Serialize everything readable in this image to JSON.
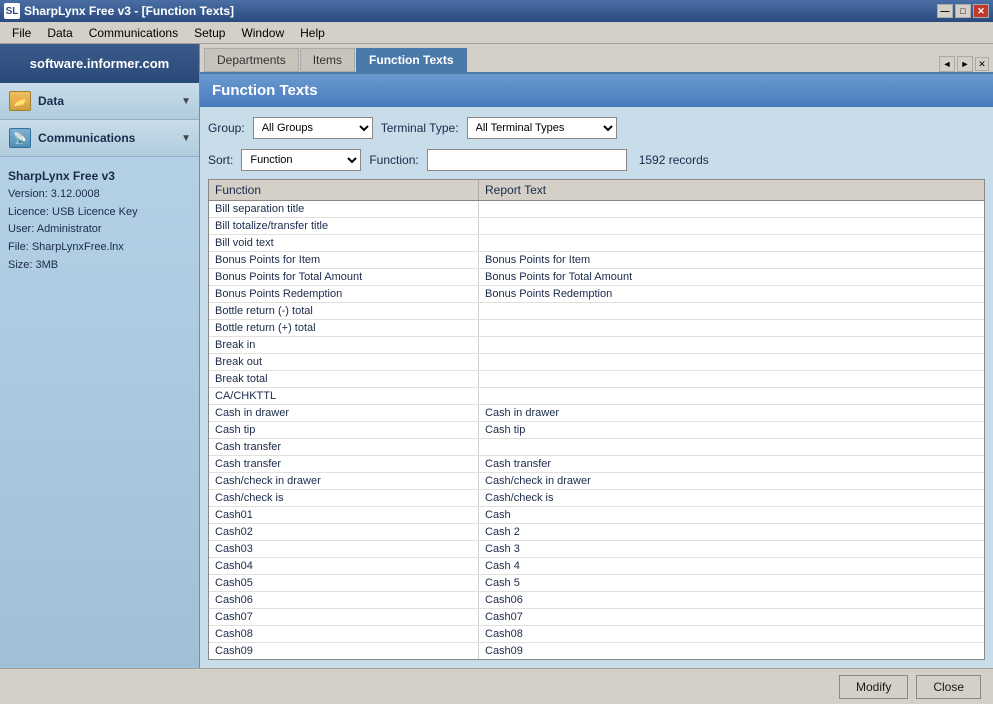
{
  "window": {
    "title": "SharpLynx Free v3 - [Function Texts]",
    "icon": "SL"
  },
  "menubar": {
    "items": [
      "File",
      "Data",
      "Communications",
      "Setup",
      "Window",
      "Help"
    ]
  },
  "sidebar": {
    "logo": "software.informer.com",
    "sections": [
      {
        "id": "data",
        "label": "Data",
        "icon": "📂"
      },
      {
        "id": "communications",
        "label": "Communications",
        "icon": "📡"
      }
    ],
    "info": {
      "app_name": "SharpLynx Free v3",
      "version": "Version: 3.12.0008",
      "licence": "Licence: USB Licence Key",
      "user": "User: Administrator",
      "file": "File: SharpLynxFree.lnx",
      "size": "Size: 3MB"
    }
  },
  "tabs": {
    "items": [
      {
        "id": "departments",
        "label": "Departments",
        "active": false
      },
      {
        "id": "items",
        "label": "Items",
        "active": false
      },
      {
        "id": "function-texts",
        "label": "Function Texts",
        "active": true
      }
    ]
  },
  "panel": {
    "title": "Function Texts",
    "filters": {
      "group_label": "Group:",
      "group_value": "All Groups",
      "group_options": [
        "All Groups"
      ],
      "terminal_type_label": "Terminal Type:",
      "terminal_type_value": "All Terminal Types",
      "terminal_type_options": [
        "All Terminal Types"
      ],
      "sort_label": "Sort:",
      "sort_value": "Function",
      "sort_options": [
        "Function"
      ],
      "function_label": "Function:",
      "function_value": "",
      "records_label": "1592 records"
    },
    "table": {
      "columns": [
        "Function",
        "Report Text"
      ],
      "rows": [
        {
          "function": "Bill separation title",
          "report_text": ""
        },
        {
          "function": "Bill totalize/transfer title",
          "report_text": ""
        },
        {
          "function": "Bill void text",
          "report_text": ""
        },
        {
          "function": "Bonus Points for Item",
          "report_text": "Bonus Points for Item"
        },
        {
          "function": "Bonus Points for Total Amount",
          "report_text": "Bonus Points for Total Amount"
        },
        {
          "function": "Bonus Points Redemption",
          "report_text": "Bonus Points Redemption"
        },
        {
          "function": "Bottle return (-) total",
          "report_text": ""
        },
        {
          "function": "Bottle return (+) total",
          "report_text": ""
        },
        {
          "function": "Break in",
          "report_text": ""
        },
        {
          "function": "Break out",
          "report_text": ""
        },
        {
          "function": "Break total",
          "report_text": ""
        },
        {
          "function": "CA/CHKTTL",
          "report_text": ""
        },
        {
          "function": "Cash in drawer",
          "report_text": "Cash in drawer"
        },
        {
          "function": "Cash tip",
          "report_text": "Cash tip"
        },
        {
          "function": "Cash transfer",
          "report_text": ""
        },
        {
          "function": "Cash transfer",
          "report_text": "Cash transfer"
        },
        {
          "function": "Cash/check in drawer",
          "report_text": "Cash/check in drawer"
        },
        {
          "function": "Cash/check is",
          "report_text": "Cash/check is"
        },
        {
          "function": "Cash01",
          "report_text": "Cash"
        },
        {
          "function": "Cash02",
          "report_text": "Cash 2"
        },
        {
          "function": "Cash03",
          "report_text": "Cash 3"
        },
        {
          "function": "Cash04",
          "report_text": "Cash 4"
        },
        {
          "function": "Cash05",
          "report_text": "Cash 5"
        },
        {
          "function": "Cash06",
          "report_text": "Cash06"
        },
        {
          "function": "Cash07",
          "report_text": "Cash07"
        },
        {
          "function": "Cash08",
          "report_text": "Cash08"
        },
        {
          "function": "Cash09",
          "report_text": "Cash09"
        }
      ]
    }
  },
  "buttons": {
    "modify": "Modify",
    "close": "Close"
  },
  "titlebar_buttons": {
    "minimize": "—",
    "maximize": "□",
    "close": "✕"
  }
}
